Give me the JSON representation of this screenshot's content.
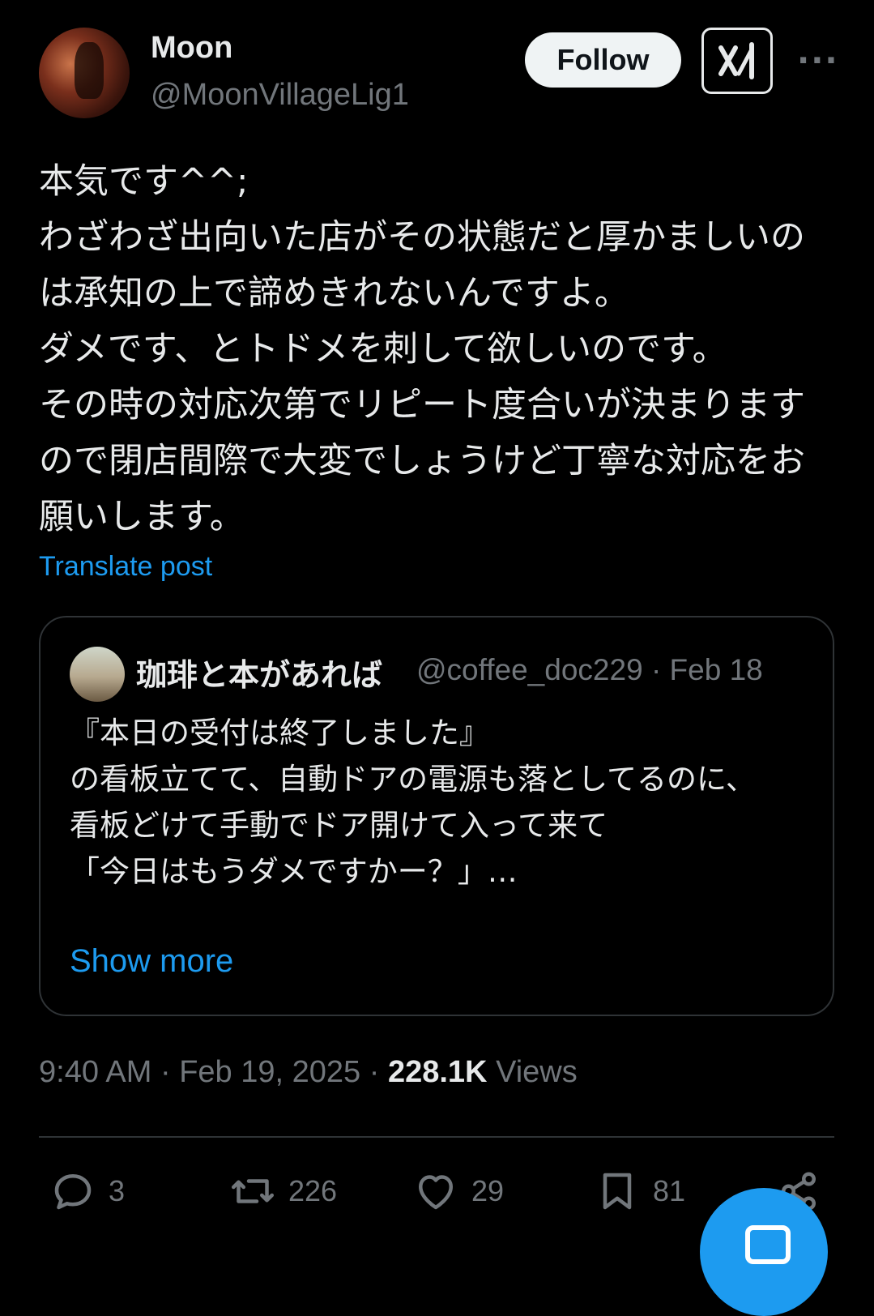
{
  "author": {
    "name": "Moon",
    "handle": "@MoonVillageLig1",
    "avatar_icon": "profile-avatar"
  },
  "header": {
    "follow_label": "Follow",
    "grok_icon": "grok-icon",
    "more_icon": "more-dots-icon"
  },
  "post": {
    "text": "本気です^^;\nわざわざ出向いた店がその状態だと厚かましいのは承知の上で諦めきれないんですよ。\nダメです、とトドメを刺して欲しいのです。\nその時の対応次第でリピート度合いが決まりますので閉店間際で大変でしょうけど丁寧な対応をお願いします。",
    "translate_label": "Translate post"
  },
  "quote": {
    "name": "珈琲と本があれば",
    "handle": "@coffee_doc229",
    "separator": "·",
    "date": "Feb 18",
    "text": "『本日の受付は終了しました』\nの看板立てて、自動ドアの電源も落としてるのに、\n看板どけて手動でドア開けて入って来て\n「今日はもうダメですかー？」…",
    "show_more_label": "Show more"
  },
  "meta": {
    "time": "9:40 AM",
    "sep1": "·",
    "date": "Feb 19, 2025",
    "sep2": "·",
    "views_count": "228.1K",
    "views_label": "Views"
  },
  "actions": {
    "reply_count": "3",
    "repost_count": "226",
    "like_count": "29",
    "bookmark_count": "81"
  },
  "colors": {
    "background": "#000000",
    "text": "#e7e9ea",
    "secondary": "#71767b",
    "accent": "#1d9bf0",
    "border": "#2f3336"
  }
}
